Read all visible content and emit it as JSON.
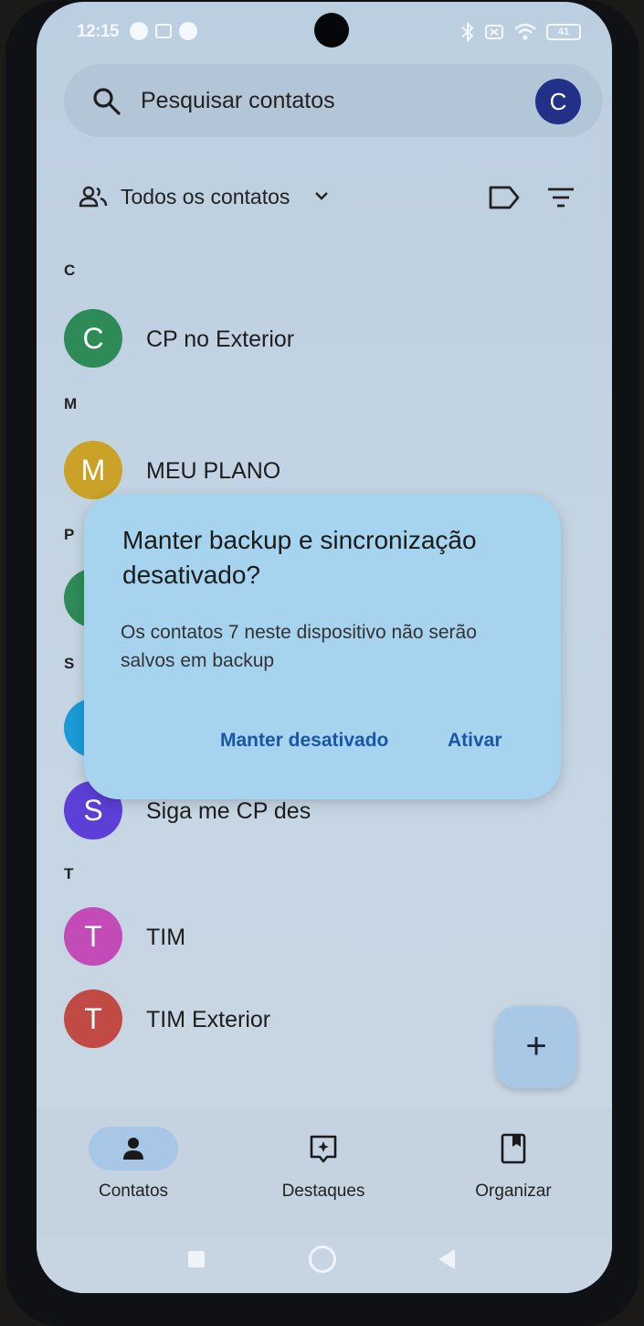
{
  "status_bar": {
    "time": "12:15",
    "battery": "41"
  },
  "search": {
    "placeholder": "Pesquisar contatos",
    "account_initial": "C"
  },
  "filter": {
    "label": "Todos os contatos"
  },
  "sections": [
    "C",
    "M",
    "P",
    "S",
    "T"
  ],
  "contacts": [
    {
      "initial": "C",
      "name": "CP no Exterior",
      "color": "#2e8b57"
    },
    {
      "initial": "M",
      "name": "MEU PLANO",
      "color": "#c9a227"
    },
    {
      "initial": "",
      "name": "",
      "color": "#2e8b57"
    },
    {
      "initial": "",
      "name": "",
      "color": "#1a9bd7"
    },
    {
      "initial": "S",
      "name": "Siga me CP des",
      "color": "#5b3fd6"
    },
    {
      "initial": "T",
      "name": "TIM",
      "color": "#c24bb8"
    },
    {
      "initial": "T",
      "name": "TIM Exterior",
      "color": "#c24a45"
    }
  ],
  "fab": {
    "label": "+"
  },
  "dialog": {
    "title": "Manter backup e sincronização desativado?",
    "body": "Os contatos 7 neste dispositivo não serão salvos em backup",
    "secondary_button": "Manter desativado",
    "primary_button": "Ativar"
  },
  "bottom_nav": [
    {
      "label": "Contatos",
      "icon": "person-icon",
      "active": true
    },
    {
      "label": "Destaques",
      "icon": "highlights-icon",
      "active": false
    },
    {
      "label": "Organizar",
      "icon": "organize-icon",
      "active": false
    }
  ]
}
